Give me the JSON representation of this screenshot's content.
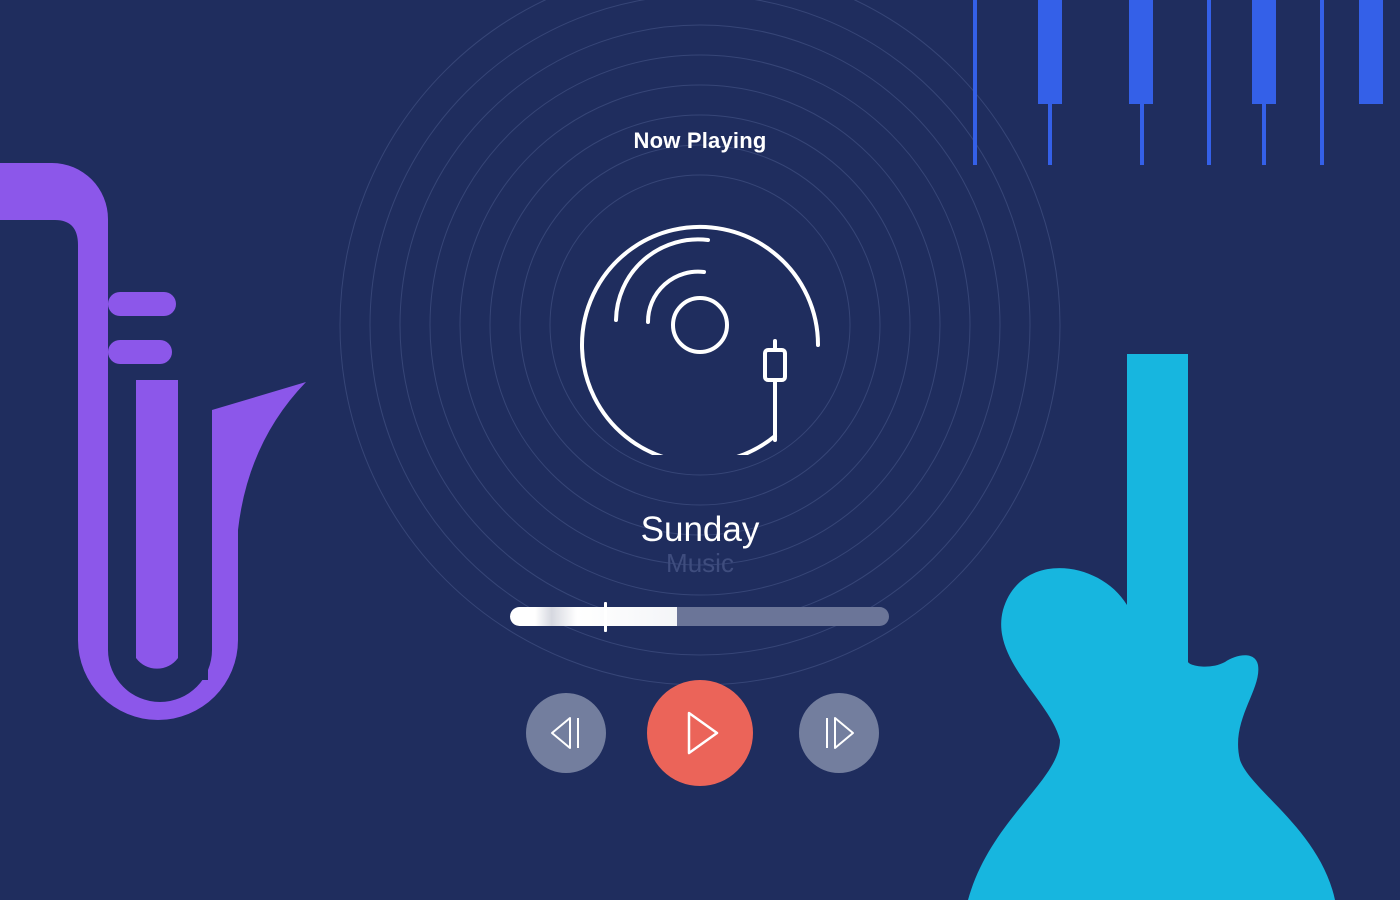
{
  "player": {
    "header": "Now Playing",
    "track_title": "Sunday",
    "track_subtitle": "Music",
    "progress": 0.44,
    "playhead": 0.25
  },
  "controls": {
    "previous": "previous",
    "play": "play",
    "next": "next"
  },
  "icons": {
    "record": "vinyl-record-icon",
    "previous": "skip-previous-icon",
    "play": "play-icon",
    "next": "skip-next-icon"
  },
  "colors": {
    "background": "#1f2d5e",
    "saxophone": "#8c57ea",
    "guitar": "#17b6df",
    "piano_keys": "#3460e8",
    "play_button": "#eb6459",
    "secondary_button": "#737e9e",
    "track_subtitle": "#3f4d7e"
  }
}
